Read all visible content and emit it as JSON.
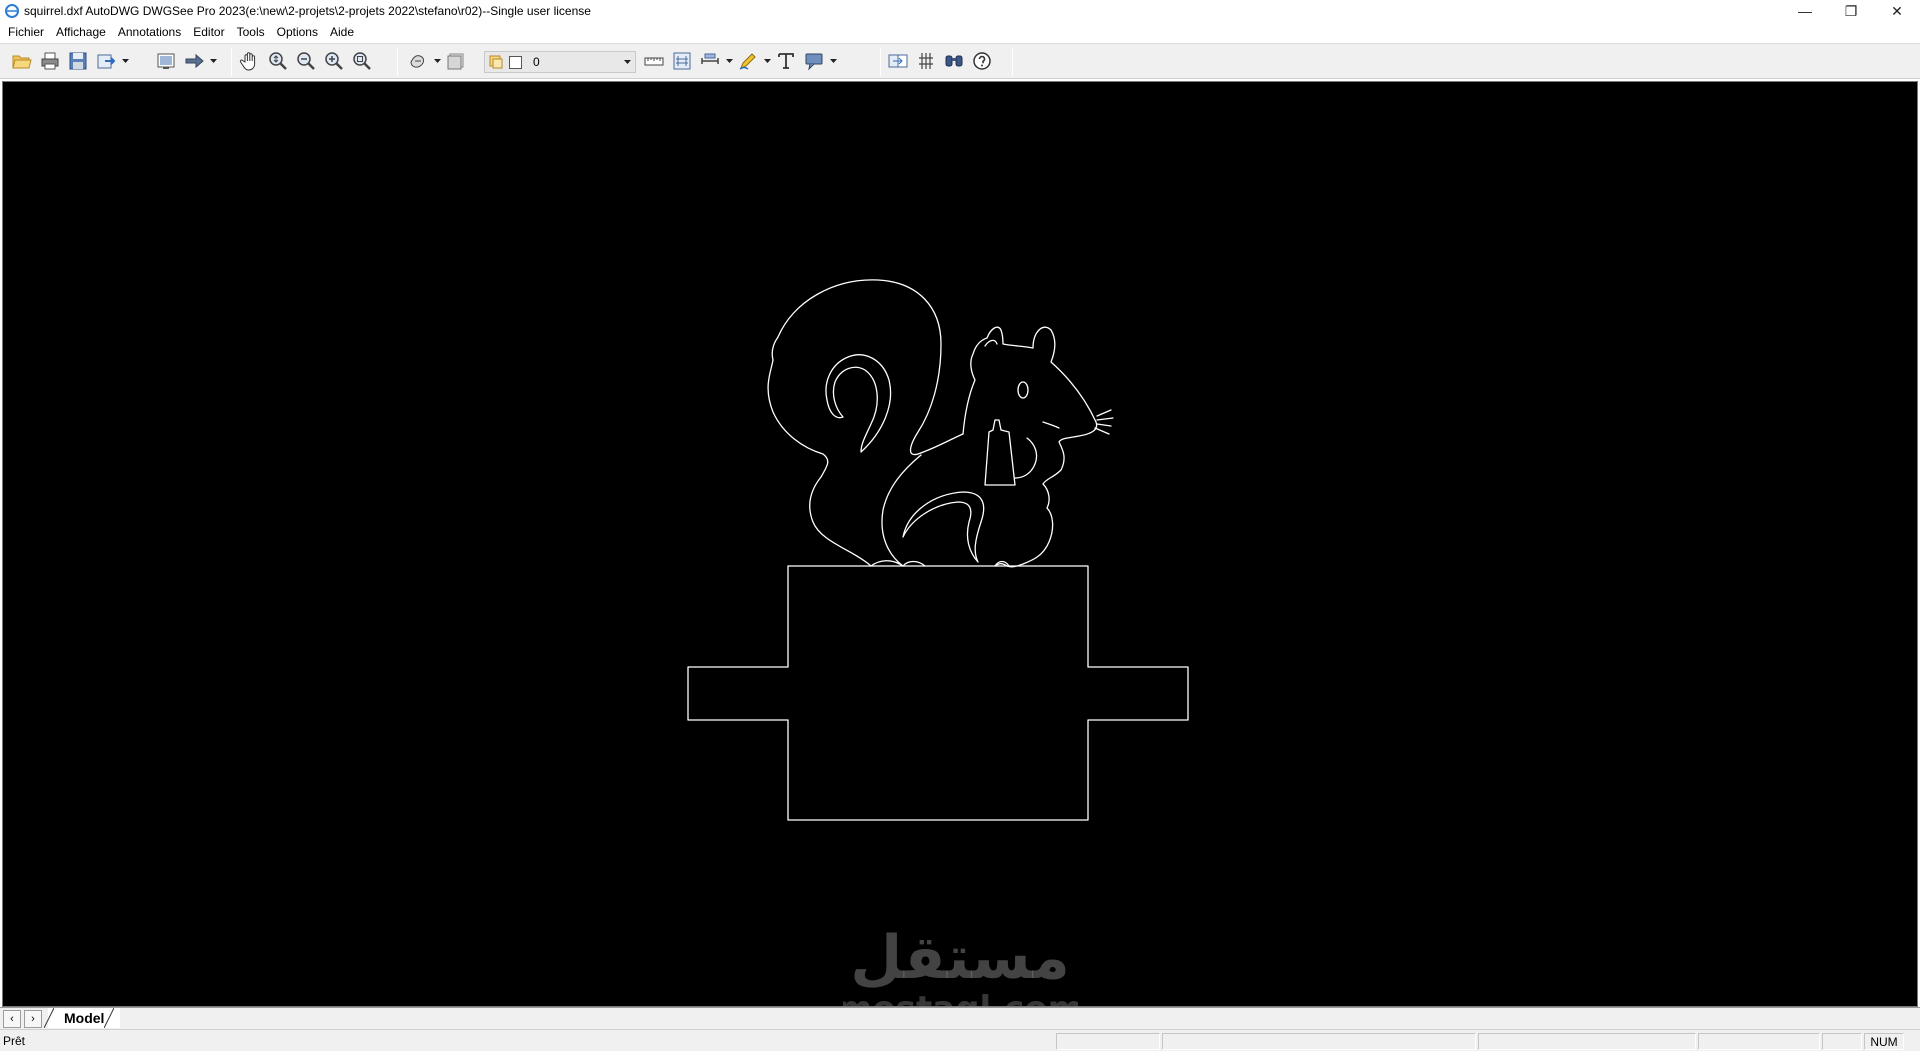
{
  "window": {
    "title": "squirrel.dxf AutoDWG DWGSee Pro 2023(e:\\new\\2-projets\\2-projets 2022\\stefano\\r02)--Single user license",
    "minimize": "—",
    "maximize": "❐",
    "close": "✕"
  },
  "menu": {
    "items": [
      "Fichier",
      "Affichage",
      "Annotations",
      "Editor",
      "Tools",
      "Options",
      "Aide"
    ]
  },
  "toolbar": {
    "layer_name": "0",
    "icons": [
      "open-icon",
      "print-icon",
      "save-icon",
      "export-icon",
      "view-icon",
      "next-icon",
      "pan-icon",
      "zoom-realtime-icon",
      "zoom-out-icon",
      "zoom-in-icon",
      "zoom-extents-icon",
      "layer-states-icon",
      "layer-icon",
      "measure-icon",
      "dimension-icon",
      "distance-icon",
      "markup-pen-icon",
      "text-icon",
      "comment-icon",
      "compare-icon",
      "hatch-icon",
      "find-icon",
      "help-icon"
    ]
  },
  "tabs": {
    "prev": "‹",
    "next": "›",
    "model": "Model"
  },
  "status": {
    "ready": "Prêt",
    "num": "NUM"
  },
  "watermark": {
    "arabic": "مستقل",
    "latin": "mostaql.com"
  },
  "colors": {
    "canvas_bg": "#000000",
    "drawing_stroke": "#ffffff",
    "chrome_bg": "#f0f0f0"
  }
}
